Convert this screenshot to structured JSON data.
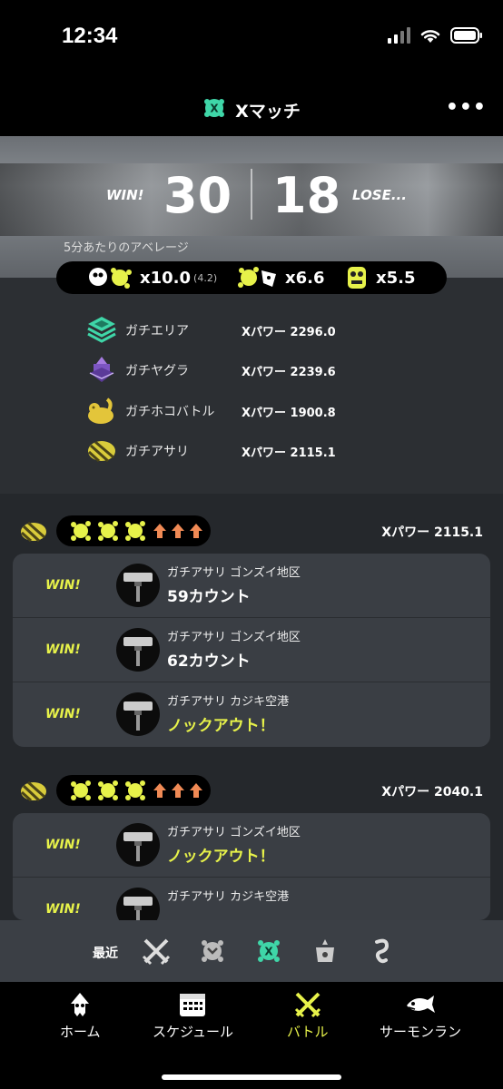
{
  "status_bar": {
    "time": "12:34"
  },
  "header": {
    "title": "Xマッチ",
    "more": "•••"
  },
  "score": {
    "win_label": "WIN!",
    "wins": "30",
    "losses": "18",
    "lose_label": "LOSE...",
    "average_label": "5分あたりのアベレージ"
  },
  "stats": {
    "kills": "x10.0",
    "assists": "(4.2)",
    "deaths": "x6.6",
    "specials": "x5.5"
  },
  "modes": [
    {
      "name": "ガチエリア",
      "power": "Xパワー 2296.0",
      "icon": "splat-zones-icon"
    },
    {
      "name": "ガチヤグラ",
      "power": "Xパワー 2239.6",
      "icon": "tower-control-icon"
    },
    {
      "name": "ガチホコバトル",
      "power": "Xパワー 1900.8",
      "icon": "rainmaker-icon"
    },
    {
      "name": "ガチアサリ",
      "power": "Xパワー 2115.1",
      "icon": "clam-blitz-icon"
    }
  ],
  "sets": [
    {
      "power": "Xパワー 2115.1",
      "matches": [
        {
          "result": "WIN!",
          "stage": "ガチアサリ ゴンズイ地区",
          "detail": "59カウント",
          "ko": false
        },
        {
          "result": "WIN!",
          "stage": "ガチアサリ ゴンズイ地区",
          "detail": "62カウント",
          "ko": false
        },
        {
          "result": "WIN!",
          "stage": "ガチアサリ カジキ空港",
          "detail": "ノックアウト！",
          "ko": true
        }
      ]
    },
    {
      "power": "Xパワー 2040.1",
      "matches": [
        {
          "result": "WIN!",
          "stage": "ガチアサリ ゴンズイ地区",
          "detail": "ノックアウト！",
          "ko": true
        },
        {
          "result": "WIN!",
          "stage": "ガチアサリ カジキ空港",
          "detail": "",
          "ko": false
        }
      ]
    }
  ],
  "recent": {
    "label": "最近"
  },
  "tabs": [
    {
      "label": "ホーム",
      "icon": "squid-icon"
    },
    {
      "label": "スケジュール",
      "icon": "calendar-icon"
    },
    {
      "label": "バトル",
      "icon": "battle-icon",
      "active": true
    },
    {
      "label": "サーモンラン",
      "icon": "salmon-icon"
    }
  ],
  "colors": {
    "accent": "#e7f24a",
    "orange": "#f08a55",
    "teal": "#3fd6a8"
  }
}
